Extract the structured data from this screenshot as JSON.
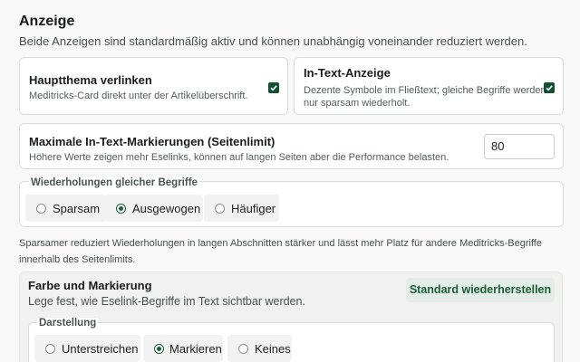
{
  "section": {
    "title": "Anzeige",
    "subtitle": "Beide Anzeigen sind standardmäßig aktiv und können unabhängig voneinander reduziert werden."
  },
  "main_topic": {
    "title": "Hauptthema verlinken",
    "desc": "Meditricks-Card direkt unter der Artikelüberschrift.",
    "checked": true
  },
  "in_text": {
    "title": "In-Text-Anzeige",
    "desc_line1": "Dezente Symbole im Fließtext; gleiche Begriffe werden",
    "desc_line2": "nur sparsam wiederholt.",
    "checked": true
  },
  "max_marks": {
    "title": "Maximale In-Text-Markierungen (Seitenlimit)",
    "desc": "Höhere Werte zeigen mehr Eselinks, können auf langen Seiten aber die Performance belasten.",
    "value": "80"
  },
  "repetitions": {
    "legend": "Wiederholungen gleicher Begriffe",
    "options": [
      "Sparsam",
      "Ausgewogen",
      "Häufiger"
    ],
    "selected": "Ausgewogen",
    "note": "Sparsamer reduziert Wiederholungen in langen Abschnitten stärker und lässt mehr Platz für andere Meditricks-Begriffe innerhalb des Seitenlimits."
  },
  "color": {
    "title": "Farbe und Markierung",
    "desc": "Lege fest, wie Eselink-Begriffe im Text sichtbar werden.",
    "restore_label": "Standard wiederherstellen",
    "display_legend": "Darstellung",
    "options": [
      "Unterstreichen",
      "Markieren",
      "Keines"
    ],
    "selected": "Markieren"
  },
  "colors": {
    "accent": "#1a5e3a",
    "checkbox": "#0f5132"
  }
}
